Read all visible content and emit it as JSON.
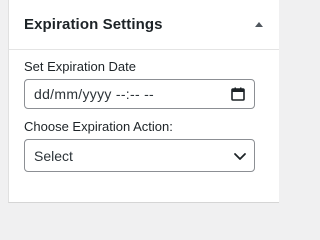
{
  "panel": {
    "title": "Expiration Settings",
    "toggle_icon": "triangle-up-icon"
  },
  "date_field": {
    "label": "Set Expiration Date",
    "value": "dd/mm/yyyy --:-- --",
    "icon": "calendar-icon"
  },
  "action_field": {
    "label": "Choose Expiration Action:",
    "selected": "Select",
    "icon": "chevron-down-icon"
  }
}
